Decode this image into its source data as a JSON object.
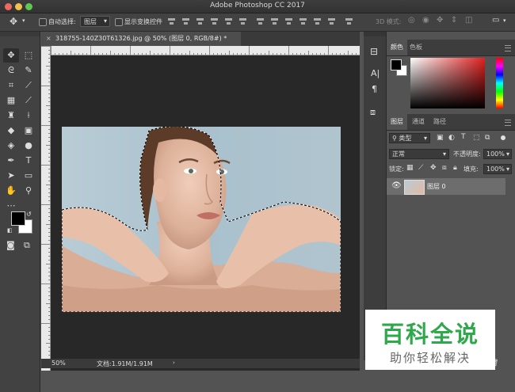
{
  "window": {
    "title": "Adobe Photoshop CC 2017"
  },
  "options_bar": {
    "auto_select_label": "自动选择:",
    "auto_select_target": "图层",
    "show_transform_label": "显示变换控件",
    "mode_3d_label": "3D 模式:"
  },
  "document": {
    "tab_title": "318755-140Z30T61326.jpg @ 50% (图层 0, RGB/8#) *",
    "close_glyph": "×",
    "zoom": "50%",
    "doc_info": "文档:1.91M/1.91M"
  },
  "panels": {
    "color_tabs": [
      "颜色",
      "色板"
    ],
    "layers_tabs": [
      "图层",
      "通道",
      "路径"
    ],
    "filter_kind": "类型",
    "blend_mode": "正常",
    "opacity_label": "不透明度:",
    "opacity_value": "100%",
    "lock_label": "锁定:",
    "fill_label": "填充:",
    "fill_value": "100%",
    "layer_name": "图层 0"
  },
  "watermark": {
    "title": "百科全说",
    "subtitle": "助你轻松解决"
  },
  "colors": {
    "chrome_dark": "#323232",
    "panel_bg": "#535353",
    "canvas_bg": "#282828",
    "layer_selected": "#6d6d6d",
    "watermark_green": "#2ea84b"
  },
  "icons": {
    "toolbar": [
      "move-icon",
      "marquee-icon",
      "lasso-icon",
      "quick-select-icon",
      "crop-icon",
      "eyedropper-icon",
      "healing-brush-icon",
      "brush-icon",
      "clone-stamp-icon",
      "history-brush-icon",
      "eraser-icon",
      "gradient-icon",
      "blur-icon",
      "dodge-icon",
      "pen-icon",
      "type-icon",
      "path-select-icon",
      "rectangle-icon",
      "hand-icon",
      "zoom-icon"
    ]
  }
}
